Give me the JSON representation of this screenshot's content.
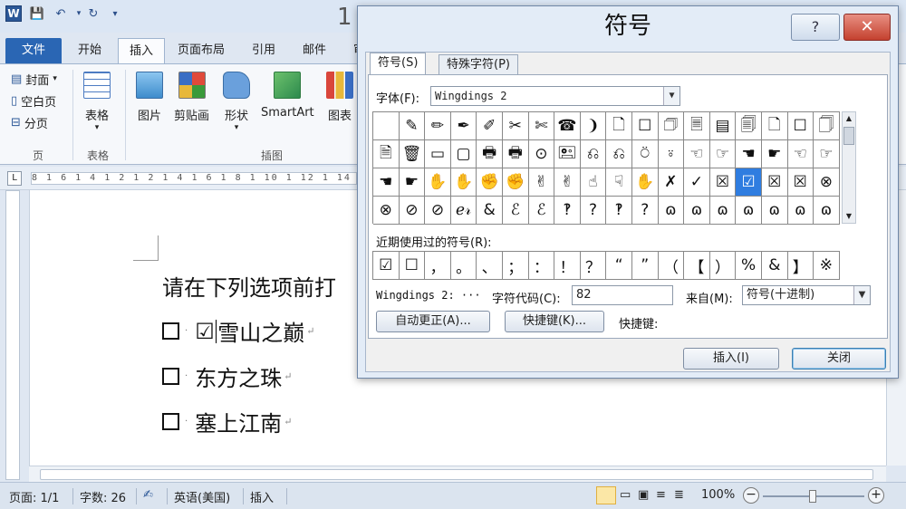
{
  "word": {
    "logo": "W",
    "title_fragment": "1",
    "quick_access": [
      "save-icon",
      "undo-icon",
      "redo-icon",
      "customize-icon"
    ],
    "tabs": [
      "文件",
      "开始",
      "插入",
      "页面布局",
      "引用",
      "邮件",
      "审"
    ],
    "active_tab": "插入",
    "ribbon": {
      "pages_group": {
        "label": "页",
        "items": [
          "封面",
          "空白页",
          "分页"
        ]
      },
      "tables_group": {
        "label": "表格",
        "button": "表格"
      },
      "illustrations_group": {
        "label": "插图",
        "buttons": [
          "图片",
          "剪贴画",
          "形状",
          "SmartArt",
          "图表"
        ]
      }
    },
    "ruler_text": "8 1 6 1 4 1 2 1   2 1 4 1 6 1 8 1 10 1 12 1 14 1",
    "document": {
      "instruction": "请在下列选项前打",
      "options": [
        {
          "text": "雪山之巅",
          "checked": true
        },
        {
          "text": "东方之珠",
          "checked": false
        },
        {
          "text": "塞上江南",
          "checked": false
        }
      ],
      "para_mark": "↵",
      "checked_glyph": "☑"
    },
    "status": {
      "page": "页面: 1/1",
      "words": "字数: 26",
      "language": "英语(美国)",
      "mode": "插入",
      "zoom": "100%",
      "zoom_minus": "−",
      "zoom_plus": "+"
    }
  },
  "dialog": {
    "title": "符号",
    "help_label": "?",
    "close_label": "✕",
    "tabs": [
      "符号(S)",
      "特殊字符(P)"
    ],
    "font_label": "字体(F):",
    "font_value": "Wingdings 2",
    "symbols": [
      "",
      "✎",
      "✏",
      "✒",
      "✐",
      "✂",
      "✄",
      "☎",
      "❩",
      "🗋",
      "☐",
      "🗇",
      "🗏",
      "▤",
      "🗐",
      "🗋",
      "☐",
      "🗍",
      "🗎",
      "🗑",
      "▭",
      "▢",
      "🖶",
      "🖶",
      "⊙",
      "🖭",
      "⎌",
      "⎌",
      "⍥",
      "⍤",
      "☜",
      "☞",
      "☚",
      "☛",
      "☜",
      "☞",
      "☚",
      "☛",
      "✋",
      "✋",
      "✊",
      "✊",
      "✌",
      "✌",
      "☝",
      "☟",
      "✋",
      "✗",
      "✓",
      "☒",
      "☑",
      "☒",
      "☒",
      "⊗",
      "⊗",
      "⊘",
      "⊘",
      "ℯ𝓇",
      "&",
      "ℰ",
      "ℰ",
      "‽",
      "?",
      "‽",
      "?",
      "ɷ",
      "ɷ",
      "ɷ",
      "ɷ",
      "ɷ",
      "ɷ",
      "ɷ"
    ],
    "selected_index": 50,
    "recent_label": "近期使用过的符号(R):",
    "recent": [
      "☑",
      "☐",
      "，",
      "。",
      "、",
      "；",
      "：",
      "！",
      "？",
      "“",
      "”",
      "（",
      "【",
      "）",
      "%",
      "&",
      "】",
      "※"
    ],
    "char_name": "Wingdings 2: ···",
    "char_code_label": "字符代码(C):",
    "char_code": "82",
    "from_label": "来自(M):",
    "from_value": "符号(十进制)",
    "autocorrect_button": "自动更正(A)...",
    "shortcut_button": "快捷键(K)...",
    "shortcut_label": "快捷键:",
    "insert_button": "插入(I)",
    "close_button": "关闭"
  }
}
